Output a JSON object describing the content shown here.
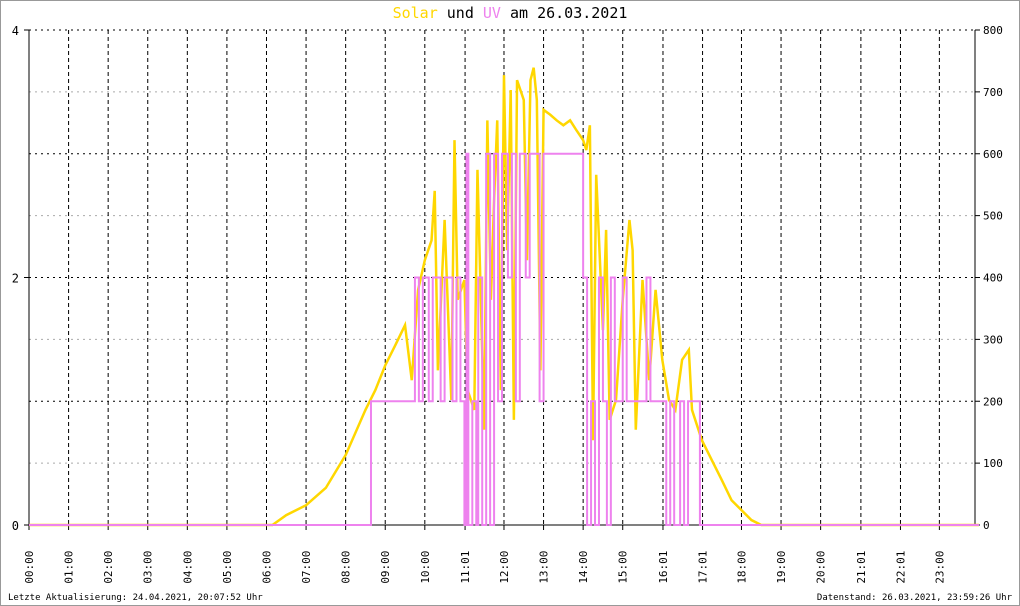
{
  "title": {
    "part1": "Solar",
    "part2": " und ",
    "part3": "UV",
    "part4": " am 26.03.2021"
  },
  "footer": {
    "left": "Letzte Aktualisierung: 24.04.2021, 20:07:52 Uhr",
    "right": "Datenstand: 26.03.2021, 23:59:26 Uhr"
  },
  "colors": {
    "solar": "#FFD700",
    "uv": "#EE82EE",
    "grid": "#000000"
  },
  "chart_data": {
    "type": "line",
    "title": "Solar und UV am 26.03.2021",
    "x_range_hours": [
      0,
      24
    ],
    "y_left": {
      "label": "UV",
      "range": [
        0,
        4
      ],
      "ticks": [
        "0",
        "2",
        "4"
      ],
      "tick_values": [
        0,
        2,
        4
      ]
    },
    "y_right": {
      "label": "Solar",
      "range": [
        0,
        800
      ],
      "ticks": [
        "0",
        "100",
        "200",
        "300",
        "400",
        "500",
        "600",
        "700",
        "800"
      ],
      "tick_values": [
        0,
        100,
        200,
        300,
        400,
        500,
        600,
        700,
        800
      ]
    },
    "x_ticks": [
      {
        "h": 0,
        "label": "26. 00:00"
      },
      {
        "h": 1,
        "label": "26. 01:00"
      },
      {
        "h": 2,
        "label": "26. 02:00"
      },
      {
        "h": 3,
        "label": "26. 03:00"
      },
      {
        "h": 4,
        "label": "26. 04:00"
      },
      {
        "h": 5,
        "label": "26. 05:00"
      },
      {
        "h": 6,
        "label": "26. 06:00"
      },
      {
        "h": 7,
        "label": "26. 07:00"
      },
      {
        "h": 8,
        "label": "26. 08:00"
      },
      {
        "h": 9,
        "label": "26. 09:00"
      },
      {
        "h": 10,
        "label": "26. 10:00"
      },
      {
        "h": 11.017,
        "label": "26. 11:01"
      },
      {
        "h": 12,
        "label": "26. 12:00"
      },
      {
        "h": 13,
        "label": "26. 13:00"
      },
      {
        "h": 14,
        "label": "26. 14:00"
      },
      {
        "h": 15,
        "label": "26. 15:00"
      },
      {
        "h": 16.017,
        "label": "26. 16:01"
      },
      {
        "h": 17.017,
        "label": "26. 17:01"
      },
      {
        "h": 18,
        "label": "26. 18:00"
      },
      {
        "h": 19,
        "label": "26. 19:00"
      },
      {
        "h": 20,
        "label": "26. 20:00"
      },
      {
        "h": 21.017,
        "label": "26. 21:01"
      },
      {
        "h": 22.017,
        "label": "26. 22:01"
      },
      {
        "h": 23,
        "label": "26. 23:00"
      }
    ],
    "series": [
      {
        "name": "Solar",
        "axis": "right",
        "color": "#FFD700",
        "points": [
          [
            0,
            0
          ],
          [
            6.15,
            0
          ],
          [
            6.5,
            16
          ],
          [
            7,
            32
          ],
          [
            7.5,
            60
          ],
          [
            8,
            113
          ],
          [
            8.5,
            186
          ],
          [
            8.75,
            218
          ],
          [
            9,
            258
          ],
          [
            9.25,
            290
          ],
          [
            9.5,
            323
          ],
          [
            9.67,
            234
          ],
          [
            9.83,
            380
          ],
          [
            10,
            428
          ],
          [
            10.17,
            460
          ],
          [
            10.25,
            540
          ],
          [
            10.33,
            250
          ],
          [
            10.5,
            493
          ],
          [
            10.67,
            202
          ],
          [
            10.75,
            622
          ],
          [
            10.83,
            364
          ],
          [
            11,
            396
          ],
          [
            11.08,
            218
          ],
          [
            11.25,
            186
          ],
          [
            11.33,
            574
          ],
          [
            11.5,
            154
          ],
          [
            11.58,
            654
          ],
          [
            11.67,
            364
          ],
          [
            11.75,
            525
          ],
          [
            11.83,
            654
          ],
          [
            11.92,
            218
          ],
          [
            12,
            727
          ],
          [
            12.08,
            444
          ],
          [
            12.17,
            703
          ],
          [
            12.25,
            170
          ],
          [
            12.33,
            719
          ],
          [
            12.5,
            687
          ],
          [
            12.58,
            428
          ],
          [
            12.67,
            719
          ],
          [
            12.75,
            739
          ],
          [
            12.83,
            687
          ],
          [
            12.92,
            250
          ],
          [
            13,
            671
          ],
          [
            13.17,
            663
          ],
          [
            13.33,
            654
          ],
          [
            13.5,
            646
          ],
          [
            13.67,
            654
          ],
          [
            13.83,
            638
          ],
          [
            14,
            622
          ],
          [
            14.08,
            606
          ],
          [
            14.17,
            646
          ],
          [
            14.25,
            137
          ],
          [
            14.33,
            566
          ],
          [
            14.5,
            315
          ],
          [
            14.58,
            477
          ],
          [
            14.67,
            170
          ],
          [
            14.83,
            202
          ],
          [
            15,
            364
          ],
          [
            15.17,
            493
          ],
          [
            15.25,
            444
          ],
          [
            15.33,
            154
          ],
          [
            15.5,
            396
          ],
          [
            15.67,
            234
          ],
          [
            15.83,
            380
          ],
          [
            16,
            267
          ],
          [
            16.17,
            202
          ],
          [
            16.33,
            186
          ],
          [
            16.5,
            267
          ],
          [
            16.67,
            283
          ],
          [
            16.75,
            186
          ],
          [
            17,
            137
          ],
          [
            17.25,
            105
          ],
          [
            17.5,
            73
          ],
          [
            17.75,
            40
          ],
          [
            18,
            24
          ],
          [
            18.25,
            8
          ],
          [
            18.5,
            0
          ],
          [
            24,
            0
          ]
        ]
      },
      {
        "name": "UV",
        "axis": "left",
        "color": "#EE82EE",
        "steps": [
          [
            0,
            0
          ],
          [
            8.64,
            1
          ],
          [
            9.75,
            2
          ],
          [
            9.85,
            1
          ],
          [
            9.95,
            2
          ],
          [
            10.1,
            1
          ],
          [
            10.2,
            2
          ],
          [
            10.4,
            1
          ],
          [
            10.5,
            2
          ],
          [
            10.7,
            1
          ],
          [
            10.8,
            2
          ],
          [
            10.9,
            1
          ],
          [
            11,
            0
          ],
          [
            11.05,
            3
          ],
          [
            11.1,
            0
          ],
          [
            11.2,
            1
          ],
          [
            11.3,
            0
          ],
          [
            11.35,
            2
          ],
          [
            11.45,
            0
          ],
          [
            11.55,
            3
          ],
          [
            11.65,
            0
          ],
          [
            11.75,
            3
          ],
          [
            11.85,
            1
          ],
          [
            11.95,
            3
          ],
          [
            12.1,
            2
          ],
          [
            12.2,
            3
          ],
          [
            12.3,
            1
          ],
          [
            12.4,
            3
          ],
          [
            12.55,
            2
          ],
          [
            12.65,
            3
          ],
          [
            12.9,
            1
          ],
          [
            13,
            3
          ],
          [
            14,
            2
          ],
          [
            14.1,
            0
          ],
          [
            14.2,
            1
          ],
          [
            14.3,
            0
          ],
          [
            14.4,
            2
          ],
          [
            14.5,
            1
          ],
          [
            14.6,
            0
          ],
          [
            14.7,
            2
          ],
          [
            14.8,
            1
          ],
          [
            15,
            2
          ],
          [
            15.1,
            1
          ],
          [
            15.3,
            1
          ],
          [
            15.5,
            1
          ],
          [
            15.6,
            2
          ],
          [
            15.7,
            1
          ],
          [
            16.1,
            0
          ],
          [
            16.2,
            1
          ],
          [
            16.3,
            0
          ],
          [
            16.45,
            1
          ],
          [
            16.55,
            0
          ],
          [
            16.65,
            1
          ],
          [
            16.95,
            0
          ],
          [
            24,
            0
          ]
        ]
      }
    ],
    "grid": true
  }
}
